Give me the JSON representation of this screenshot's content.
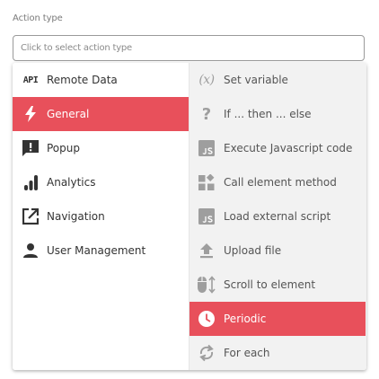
{
  "field": {
    "label": "Action type",
    "placeholder": "Click to select action type"
  },
  "categories": [
    {
      "label": "Remote Data",
      "icon": "api-icon",
      "icon_text": "API",
      "selected": false
    },
    {
      "label": "General",
      "icon": "lightning-bolt-icon",
      "selected": true
    },
    {
      "label": "Popup",
      "icon": "popup-alert-icon",
      "selected": false
    },
    {
      "label": "Analytics",
      "icon": "signal-bars-icon",
      "selected": false
    },
    {
      "label": "Navigation",
      "icon": "open-in-new-icon",
      "selected": false
    },
    {
      "label": "User Management",
      "icon": "person-icon",
      "selected": false
    }
  ],
  "actions": [
    {
      "label": "Set variable",
      "icon": "variable-x-icon",
      "icon_text": "(x)",
      "selected": false
    },
    {
      "label": "If ... then ... else",
      "icon": "question-mark-icon",
      "icon_text": "?",
      "selected": false
    },
    {
      "label": "Execute Javascript code",
      "icon": "javascript-file-icon",
      "selected": false
    },
    {
      "label": "Call element method",
      "icon": "widgets-icon",
      "selected": false
    },
    {
      "label": "Load external script",
      "icon": "javascript-file-icon",
      "selected": false
    },
    {
      "label": "Upload file",
      "icon": "upload-icon",
      "selected": false
    },
    {
      "label": "Scroll to element",
      "icon": "mouse-scroll-icon",
      "selected": false
    },
    {
      "label": "Periodic",
      "icon": "clock-icon",
      "selected": true
    },
    {
      "label": "For each",
      "icon": "loop-icon",
      "selected": false
    }
  ],
  "colors": {
    "selected_background": "#e8505b",
    "left_icon": "#333333",
    "right_icon": "#9e9e9e"
  }
}
